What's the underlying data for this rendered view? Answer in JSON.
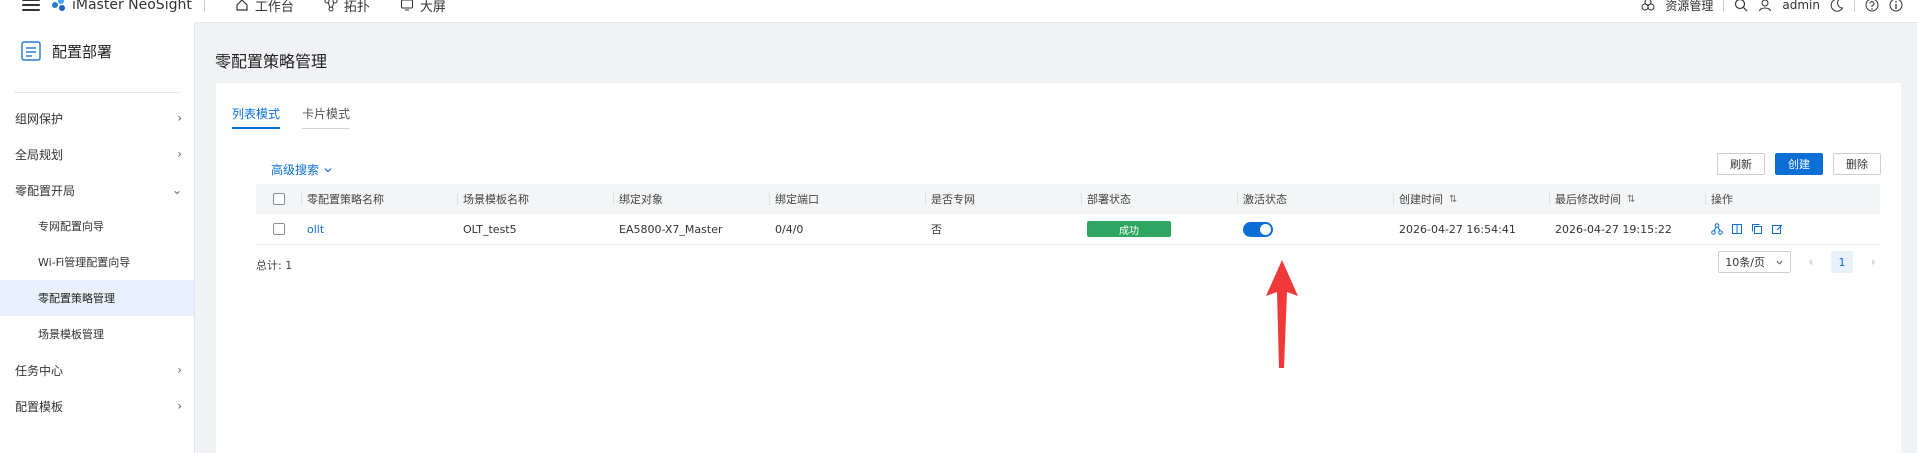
{
  "header": {
    "brand": "iMaster NeoSight",
    "nav": [
      {
        "label": "工作台",
        "icon": "home-icon"
      },
      {
        "label": "拓扑",
        "icon": "topology-icon"
      },
      {
        "label": "大屏",
        "icon": "screen-icon"
      }
    ],
    "resource_label": "资源管理",
    "user": "admin"
  },
  "sidebar": {
    "title": "配置部署",
    "items": [
      {
        "label": "组网保护",
        "type": "group",
        "chevron": "›"
      },
      {
        "label": "全局规划",
        "type": "group",
        "chevron": "›"
      },
      {
        "label": "零配置开局",
        "type": "group-open",
        "chevron": "⌄"
      },
      {
        "label": "专网配置向导",
        "type": "sub"
      },
      {
        "label": "Wi-Fi管理配置向导",
        "type": "sub"
      },
      {
        "label": "零配置策略管理",
        "type": "sub-active"
      },
      {
        "label": "场景模板管理",
        "type": "sub"
      },
      {
        "label": "任务中心",
        "type": "group",
        "chevron": "›"
      },
      {
        "label": "配置模板",
        "type": "group",
        "chevron": "›"
      }
    ]
  },
  "page": {
    "title": "零配置策略管理",
    "tabs": [
      {
        "label": "列表模式",
        "active": true
      },
      {
        "label": "卡片模式",
        "active": false
      }
    ],
    "advanced_search": "高级搜索",
    "buttons": {
      "refresh": "刷新",
      "create": "创建",
      "delete": "删除"
    }
  },
  "table": {
    "headers": [
      "零配置策略名称",
      "场景模板名称",
      "绑定对象",
      "绑定端口",
      "是否专网",
      "部署状态",
      "激活状态",
      "创建时间",
      "最后修改时间",
      "操作"
    ],
    "rows": [
      {
        "name": "ollt",
        "template": "OLT_test5",
        "bound_object": "EA5800-X7_Master",
        "bound_port": "0/4/0",
        "private_network": "否",
        "deploy_status": "成功",
        "activated": true,
        "created": "2026-04-27 16:54:41",
        "modified": "2026-04-27 19:15:22"
      }
    ]
  },
  "footer": {
    "total": "总计: 1",
    "page_size": "10条/页",
    "current_page": "1"
  },
  "colors": {
    "primary": "#0b6fd6",
    "success": "#2fa562",
    "annotation": "#f03a3a"
  }
}
